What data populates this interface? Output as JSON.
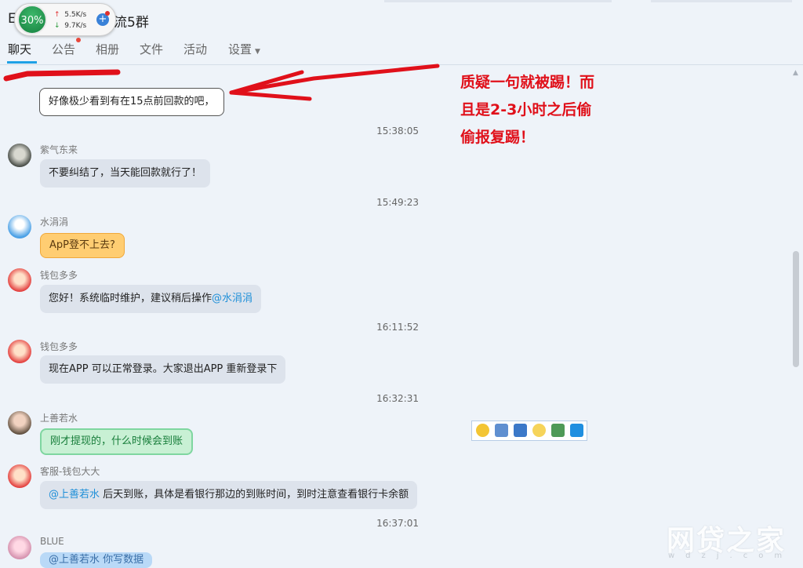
{
  "window": {
    "title_prefix": "E",
    "title_suffix": "流5群"
  },
  "network_widget": {
    "cpu": "30%",
    "up": "5.5K/s",
    "down": "9.7K/s",
    "plus": "+"
  },
  "tabs": [
    {
      "label": "聊天"
    },
    {
      "label": "公告"
    },
    {
      "label": "相册"
    },
    {
      "label": "文件"
    },
    {
      "label": "活动"
    },
    {
      "label": "设置"
    }
  ],
  "annotation": [
    "质疑一句就被踢！而",
    "且是2-3小时之后偷",
    "偷报复踢！"
  ],
  "messages": [
    {
      "text": "好像极少看到有在15点前回款的吧，",
      "time": "15:38:05"
    },
    {
      "sender": "紫气东来",
      "text": "不要纠结了，当天能回款就行了！",
      "time": "15:49:23"
    },
    {
      "sender": "水涓涓",
      "text": "ApP登不上去?"
    },
    {
      "sender": "钱包多多",
      "text": "您好！系统临时维护，建议稍后操作",
      "mention": "@水涓涓",
      "time": "16:11:52"
    },
    {
      "sender": "钱包多多",
      "text": "现在APP 可以正常登录。大家退出APP  重新登录下",
      "time": "16:32:31"
    },
    {
      "sender": "上善若水",
      "text": "刚才提现的，什么时候会到账"
    },
    {
      "sender": "客服-钱包大大",
      "mention": "@上善若水",
      "text": "   后天到账，具体是看银行那边的到账时间，到时注意查看银行卡余额",
      "time": "16:37:01"
    },
    {
      "sender": "BLUE",
      "text": "@上善若水 你写数据"
    }
  ],
  "watermark": {
    "main": "网贷之家",
    "sub": "wdzj.com"
  },
  "colors": {
    "accent": "#1fa1e6",
    "annotation": "#e0101a",
    "cpu_circle": "#16803f"
  }
}
